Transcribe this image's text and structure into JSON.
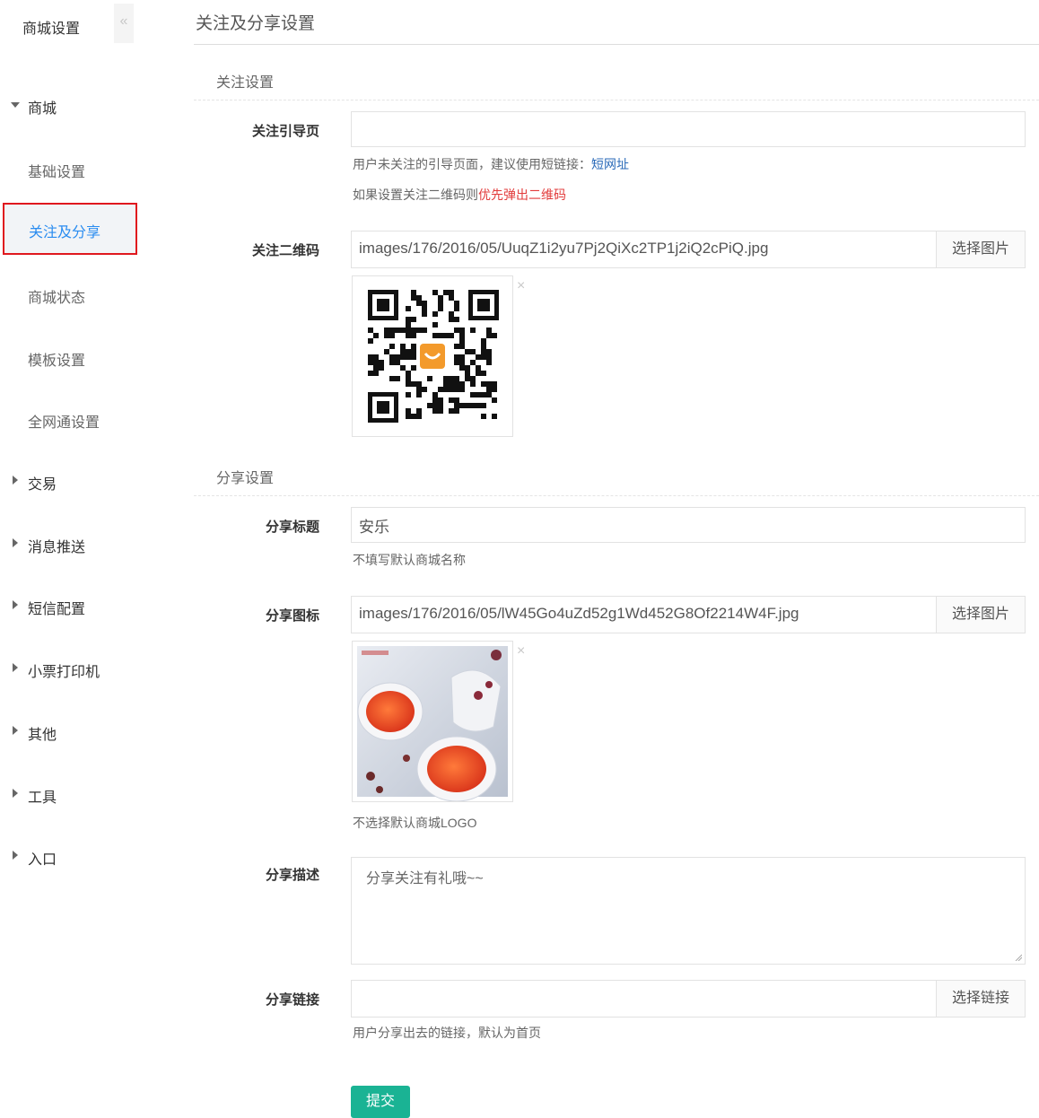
{
  "sidebar": {
    "title": "商城设置",
    "collapse_glyph": "«",
    "groups": [
      {
        "label": "商城",
        "expanded": true,
        "items": [
          {
            "label": "基础设置"
          },
          {
            "label": "关注及分享",
            "active": true
          },
          {
            "label": "商城状态"
          },
          {
            "label": "模板设置"
          },
          {
            "label": "全网通设置"
          }
        ]
      },
      {
        "label": "交易"
      },
      {
        "label": "消息推送"
      },
      {
        "label": "短信配置"
      },
      {
        "label": "小票打印机"
      },
      {
        "label": "其他"
      },
      {
        "label": "工具"
      },
      {
        "label": "入口"
      }
    ]
  },
  "page": {
    "title": "关注及分享设置"
  },
  "follow": {
    "section_title": "关注设置",
    "guide_label": "关注引导页",
    "guide_value": "",
    "guide_help_1": "用户未关注的引导页面，建议使用短链接：",
    "guide_help_link": "短网址",
    "guide_help_2_prefix": "如果设置关注二维码则",
    "guide_help_2_warn": "优先弹出二维码",
    "qr_label": "关注二维码",
    "qr_value": "images/176/2016/05/UuqZ1i2yu7Pj2QiXc2TP1j2iQ2cPiQ.jpg",
    "qr_button": "选择图片",
    "remove_glyph": "×"
  },
  "share": {
    "section_title": "分享设置",
    "title_label": "分享标题",
    "title_value": "安乐",
    "title_help": "不填写默认商城名称",
    "icon_label": "分享图标",
    "icon_value": "images/176/2016/05/lW45Go4uZd52g1Wd452G8Of2214W4F.jpg",
    "icon_button": "选择图片",
    "icon_help": "不选择默认商城LOGO",
    "remove_glyph": "×",
    "desc_label": "分享描述",
    "desc_value": "分享关注有礼哦~~",
    "link_label": "分享链接",
    "link_value": "",
    "link_button": "选择链接",
    "link_help": "用户分享出去的链接，默认为首页"
  },
  "submit_label": "提交",
  "colors": {
    "accent": "#1ab394",
    "active_text": "#2a8cf0",
    "highlight_border": "#e0181e",
    "link": "#2a6ab8",
    "warn": "#e23b3b"
  }
}
